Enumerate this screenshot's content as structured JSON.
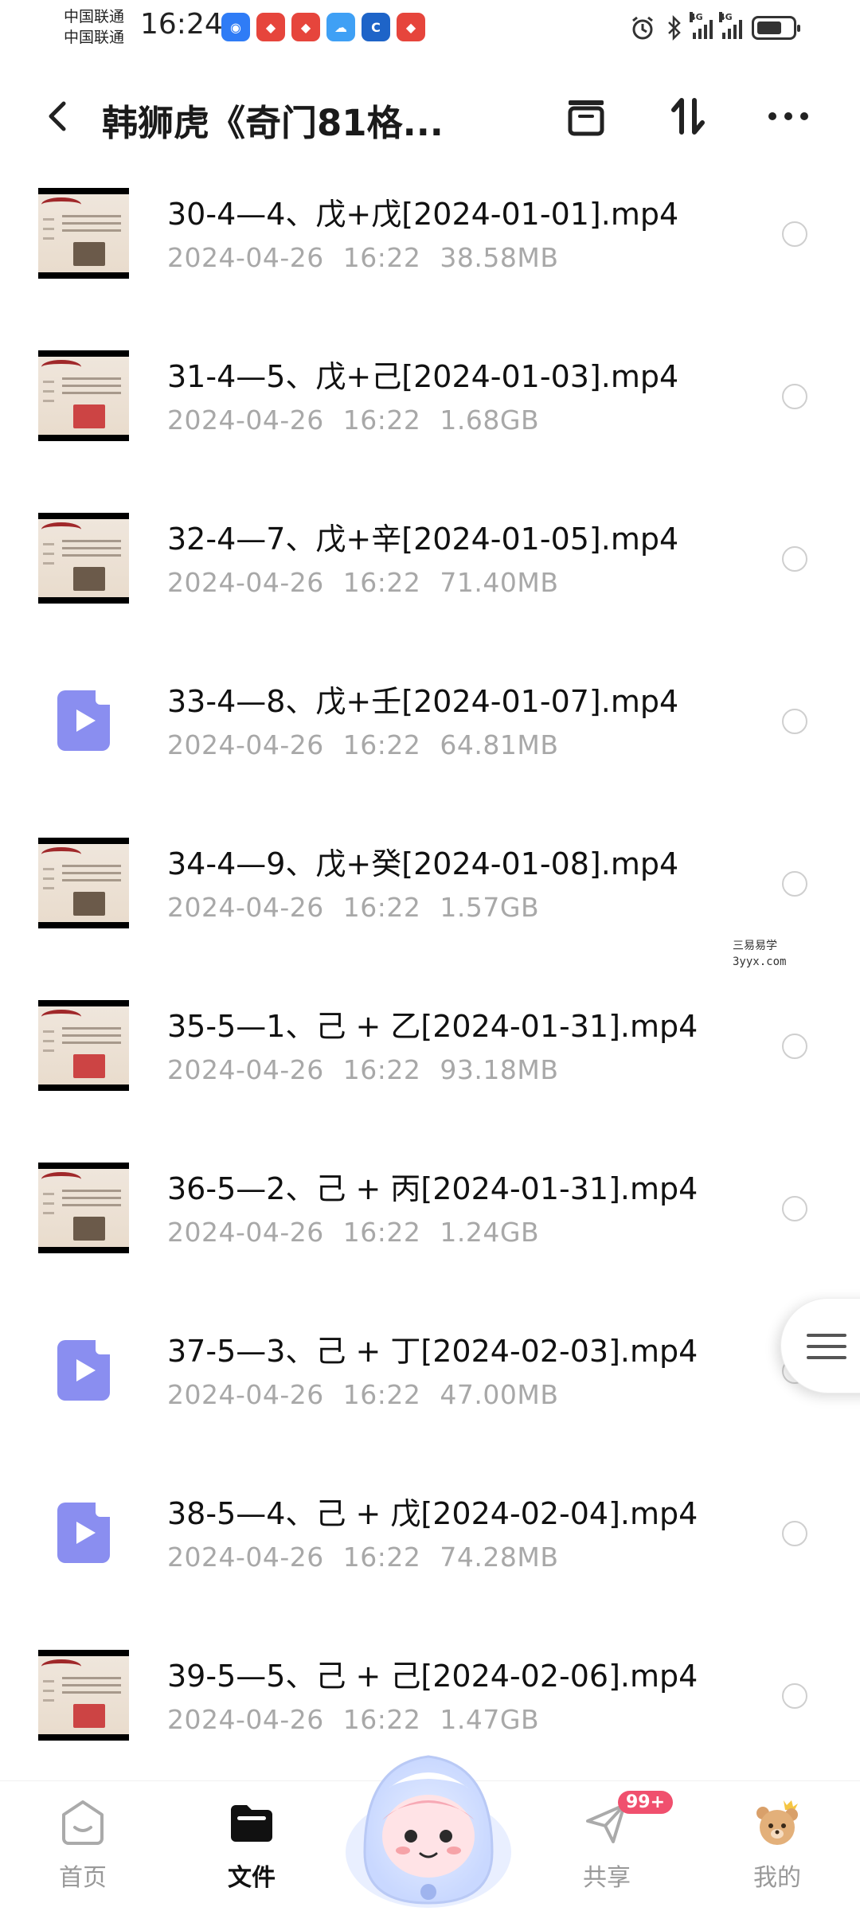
{
  "status_bar": {
    "carrier_1": "中国联通",
    "carrier_2": "中国联通",
    "time": "16:24",
    "network_1": "4G",
    "network_2": "4G"
  },
  "header": {
    "title": "韩狮虎《奇门81格...",
    "icons": [
      "back-icon",
      "archive-icon",
      "sort-icon",
      "more-icon"
    ]
  },
  "files": [
    {
      "name": "30-4—4、戊+戊[2024-01-01].mp4",
      "date": "2024-04-26",
      "time": "16:22",
      "size": "38.58MB",
      "thumb": "video"
    },
    {
      "name": "31-4—5、戊+己[2024-01-03].mp4",
      "date": "2024-04-26",
      "time": "16:22",
      "size": "1.68GB",
      "thumb": "video"
    },
    {
      "name": "32-4—7、戊+辛[2024-01-05].mp4",
      "date": "2024-04-26",
      "time": "16:22",
      "size": "71.40MB",
      "thumb": "video"
    },
    {
      "name": "33-4—8、戊+壬[2024-01-07].mp4",
      "date": "2024-04-26",
      "time": "16:22",
      "size": "64.81MB",
      "thumb": "play"
    },
    {
      "name": "34-4—9、戊+癸[2024-01-08].mp4",
      "date": "2024-04-26",
      "time": "16:22",
      "size": "1.57GB",
      "thumb": "video"
    },
    {
      "name": "35-5—1、己 + 乙[2024-01-31].mp4",
      "date": "2024-04-26",
      "time": "16:22",
      "size": "93.18MB",
      "thumb": "video"
    },
    {
      "name": "36-5—2、己 + 丙[2024-01-31].mp4",
      "date": "2024-04-26",
      "time": "16:22",
      "size": "1.24GB",
      "thumb": "video"
    },
    {
      "name": "37-5—3、己 + 丁[2024-02-03].mp4",
      "date": "2024-04-26",
      "time": "16:22",
      "size": "47.00MB",
      "thumb": "play"
    },
    {
      "name": "38-5—4、己 + 戊[2024-02-04].mp4",
      "date": "2024-04-26",
      "time": "16:22",
      "size": "74.28MB",
      "thumb": "play"
    },
    {
      "name": "39-5—5、己 + 己[2024-02-06].mp4",
      "date": "2024-04-26",
      "time": "16:22",
      "size": "1.47GB",
      "thumb": "video"
    }
  ],
  "watermark": {
    "line1": "三易易学",
    "line2": "3yyx.com"
  },
  "bottom_nav": {
    "home": "首页",
    "files": "文件",
    "share": "共享",
    "share_badge": "99+",
    "mine": "我的"
  },
  "colors": {
    "accent_play": "#8a8ef0",
    "badge": "#f0506e",
    "meta": "#a8a8a8"
  }
}
